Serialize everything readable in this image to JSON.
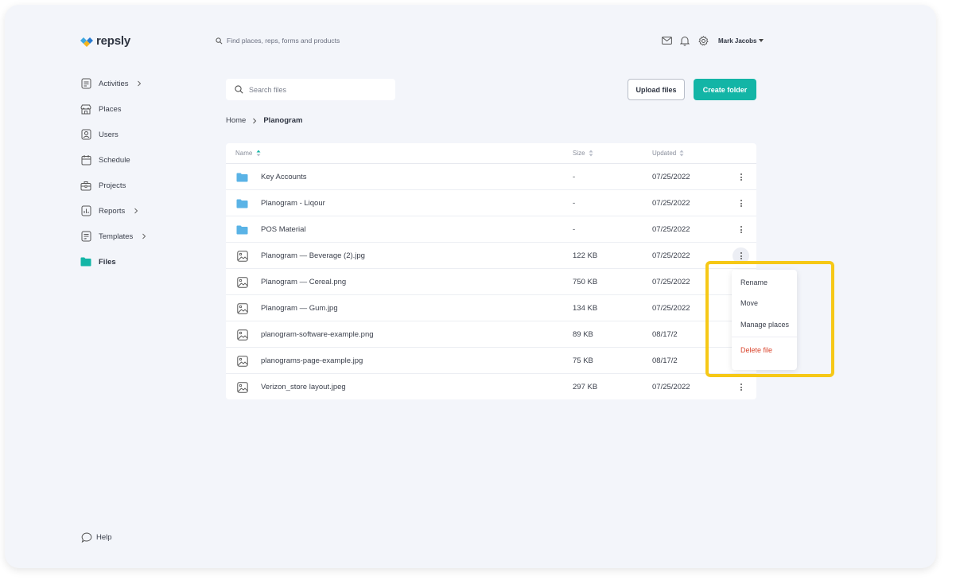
{
  "brand": {
    "name": "repsly"
  },
  "header": {
    "search_placeholder": "Find places, reps, forms and products",
    "user_name": "Mark Jacobs"
  },
  "sidebar": {
    "items": [
      {
        "label": "Activities",
        "icon": "activities-icon",
        "has_chevron": true
      },
      {
        "label": "Places",
        "icon": "store-icon",
        "has_chevron": false
      },
      {
        "label": "Users",
        "icon": "user-icon",
        "has_chevron": false
      },
      {
        "label": "Schedule",
        "icon": "calendar-icon",
        "has_chevron": false
      },
      {
        "label": "Projects",
        "icon": "briefcase-icon",
        "has_chevron": false
      },
      {
        "label": "Reports",
        "icon": "chart-icon",
        "has_chevron": true
      },
      {
        "label": "Templates",
        "icon": "template-icon",
        "has_chevron": true
      },
      {
        "label": "Files",
        "icon": "folder-icon",
        "has_chevron": false,
        "active": true
      }
    ],
    "help_label": "Help"
  },
  "main": {
    "search_placeholder": "Search files",
    "upload_label": "Upload files",
    "create_label": "Create folder",
    "breadcrumb": {
      "home": "Home",
      "current": "Planogram"
    }
  },
  "table": {
    "columns": {
      "name": "Name",
      "size": "Size",
      "updated": "Updated"
    },
    "rows": [
      {
        "type": "folder",
        "name": "Key Accounts",
        "size": "-",
        "updated": "07/25/2022"
      },
      {
        "type": "folder",
        "name": "Planogram - Liqour",
        "size": "-",
        "updated": "07/25/2022"
      },
      {
        "type": "folder",
        "name": "POS Material",
        "size": "-",
        "updated": "07/25/2022"
      },
      {
        "type": "image",
        "name": "Planogram — Beverage (2).jpg",
        "size": "122 KB",
        "updated": "07/25/2022"
      },
      {
        "type": "image",
        "name": "Planogram — Cereal.png",
        "size": "750 KB",
        "updated": "07/25/2022"
      },
      {
        "type": "image",
        "name": "Planogram — Gum.jpg",
        "size": "134 KB",
        "updated": "07/25/2022"
      },
      {
        "type": "image",
        "name": "planogram-software-example.png",
        "size": "89 KB",
        "updated": "08/17/2"
      },
      {
        "type": "image",
        "name": "planograms-page-example.jpg",
        "size": "75 KB",
        "updated": "08/17/2"
      },
      {
        "type": "image",
        "name": "Verizon_store layout.jpeg",
        "size": "297 KB",
        "updated": "07/25/2022"
      }
    ]
  },
  "context_menu": {
    "rename": "Rename",
    "move": "Move",
    "manage_places": "Manage places",
    "delete": "Delete file"
  },
  "colors": {
    "accent": "#13b5a6",
    "folder": "#5ab3e6",
    "highlight": "#f6c816",
    "danger": "#d9432b",
    "background": "#f3f5fa"
  }
}
